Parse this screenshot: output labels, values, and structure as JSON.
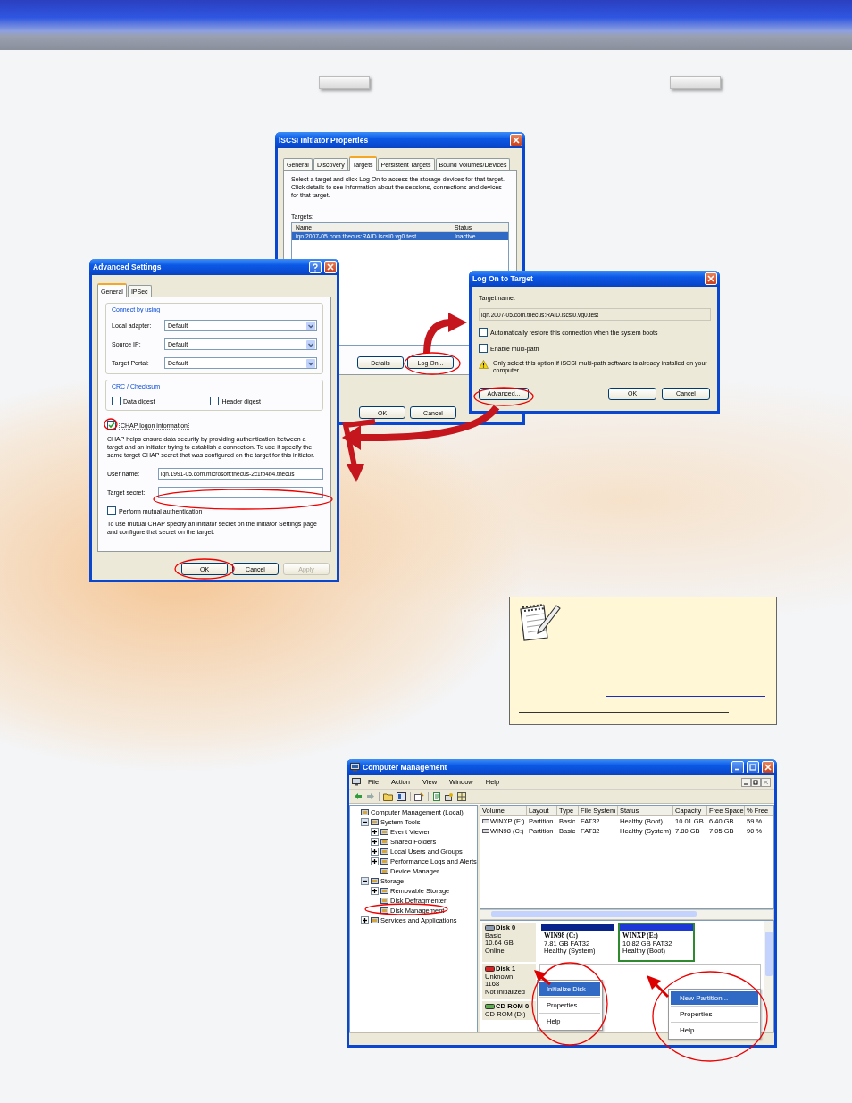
{
  "iscsi_window": {
    "title": "iSCSI Initiator Properties",
    "tabs": [
      {
        "label": "General",
        "selected": false
      },
      {
        "label": "Discovery",
        "selected": false
      },
      {
        "label": "Targets",
        "selected": true
      },
      {
        "label": "Persistent Targets",
        "selected": false
      },
      {
        "label": "Bound Volumes/Devices",
        "selected": false
      }
    ],
    "description": "Select a target and click Log On to access the storage devices for that target. Click details to see information about the sessions, connections and devices for that target.",
    "targets_label": "Targets:",
    "columns": [
      "Name",
      "Status"
    ],
    "rows": [
      {
        "name": "iqn.2007-05.com.thecus:RAID.iscsi0.vg0.test",
        "status": "Inactive",
        "selected": true
      }
    ],
    "list_buttons": [
      "Details",
      "Log On..."
    ],
    "footer_buttons": [
      "OK",
      "Cancel"
    ]
  },
  "advanced_settings": {
    "title": "Advanced Settings",
    "tabs": [
      {
        "label": "General",
        "selected": true
      },
      {
        "label": "IPSec",
        "selected": false
      }
    ],
    "connect_group": "Connect by using",
    "fields": [
      {
        "label": "Local adapter:",
        "value": "Default"
      },
      {
        "label": "Source IP:",
        "value": "Default"
      },
      {
        "label": "Target Portal:",
        "value": "Default"
      }
    ],
    "crc_group": "CRC / Checksum",
    "digests": [
      {
        "label": "Data digest",
        "checked": false
      },
      {
        "label": "Header digest",
        "checked": false
      }
    ],
    "chap": {
      "label": "CHAP logon information",
      "checked": true
    },
    "chap_text": "CHAP helps ensure data security by providing authentication between a target and an initiator trying to establish a connection. To use it specify the same target CHAP secret that was configured on the target for this initiator.",
    "user_name": {
      "label": "User name:",
      "value": "iqn.1991-05.com.microsoft:thecus-2c1fb4b4.thecus"
    },
    "target_secret": {
      "label": "Target secret:"
    },
    "mutual": {
      "label": "Perform mutual authentication",
      "checked": false
    },
    "mutual_text": "To use mutual CHAP specify an initiator secret on the Initiator Settings page and configure that secret on the target.",
    "buttons": [
      {
        "label": "OK",
        "disabled": false
      },
      {
        "label": "Cancel",
        "disabled": false
      },
      {
        "label": "Apply",
        "disabled": true
      }
    ]
  },
  "log_on_window": {
    "title": "Log On to Target",
    "target_label": "Target name:",
    "target_value": "iqn.2007-05.com.thecus:RAID.iscsi0.vg0.test",
    "options": [
      {
        "label": "Automatically restore this connection when the system boots",
        "checked": false
      },
      {
        "label": "Enable multi-path",
        "checked": false
      }
    ],
    "warning": "Only select this option if iSCSI multi-path software is already installed on your computer.",
    "advanced_button": "Advanced...",
    "buttons": [
      "OK",
      "Cancel"
    ]
  },
  "computer_management": {
    "title": "Computer Management",
    "menu": [
      "File",
      "Action",
      "View",
      "Window",
      "Help"
    ],
    "tree": [
      {
        "label": "Computer Management (Local)",
        "children": [
          {
            "label": "System Tools",
            "expanded": true,
            "children": [
              {
                "label": "Event Viewer",
                "expanded": false
              },
              {
                "label": "Shared Folders",
                "expanded": false
              },
              {
                "label": "Local Users and Groups",
                "expanded": false
              },
              {
                "label": "Performance Logs and Alerts",
                "expanded": false
              },
              {
                "label": "Device Manager"
              }
            ]
          },
          {
            "label": "Storage",
            "expanded": true,
            "children": [
              {
                "label": "Removable Storage",
                "expanded": false
              },
              {
                "label": "Disk Defragmenter"
              },
              {
                "label": "Disk Management"
              }
            ]
          },
          {
            "label": "Services and Applications",
            "expanded": false
          }
        ]
      }
    ],
    "columns": [
      "Volume",
      "Layout",
      "Type",
      "File System",
      "Status",
      "Capacity",
      "Free Space",
      "% Free"
    ],
    "volumes": [
      [
        "WINXP (E:)",
        "Partition",
        "Basic",
        "FAT32",
        "Healthy (Boot)",
        "10.01 GB",
        "6.40 GB",
        "59 %"
      ],
      [
        "WIN98 (C:)",
        "Partition",
        "Basic",
        "FAT32",
        "Healthy (System)",
        "7.80 GB",
        "7.05 GB",
        "90 %"
      ]
    ],
    "disks": [
      {
        "kind": "disk",
        "name": "Disk 0",
        "lines": [
          "Basic",
          "10.64 GB",
          "Online"
        ],
        "partitions": [
          {
            "name": "WIN98  (C:)",
            "size": "7.81 GB FAT32",
            "status": "Healthy (System)",
            "selected": false
          },
          {
            "name": "WINXP  (E:)",
            "size": "10.82 GB FAT32",
            "status": "Healthy (Boot)",
            "selected": true
          }
        ]
      },
      {
        "kind": "uninitialized",
        "name": "Disk 1",
        "lines": [
          "Unknown",
          "1168",
          "Not Initialized"
        ]
      },
      {
        "kind": "cdrom",
        "name": "CD-ROM 0",
        "lines": [
          "CD-ROM (D:)"
        ]
      }
    ],
    "context_menus": [
      [
        {
          "label": "Initialize Disk",
          "selected": true
        },
        {
          "label": "Properties",
          "selected": false
        },
        {
          "label": "Help",
          "selected": false
        }
      ],
      [
        {
          "label": "New Partition...",
          "selected": true
        },
        {
          "label": "Properties",
          "selected": false
        },
        {
          "label": "Help",
          "selected": false
        }
      ]
    ]
  }
}
